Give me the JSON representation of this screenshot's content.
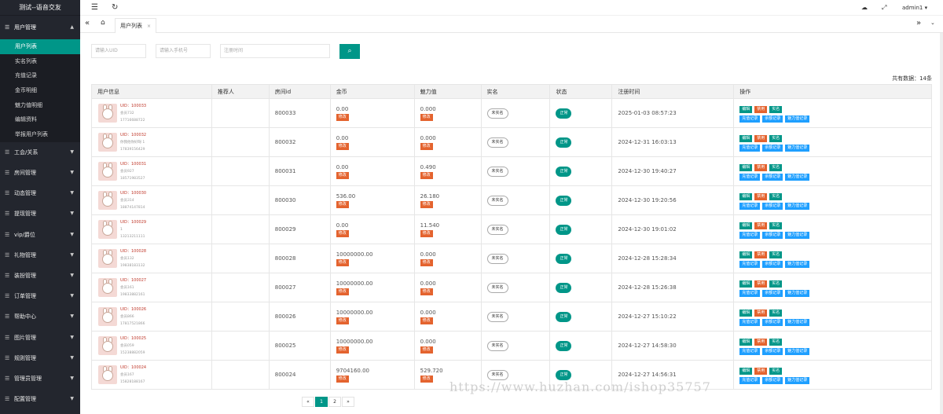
{
  "app_title": "测试--语音交友",
  "sidebar": {
    "groups": [
      {
        "label": "用户管理",
        "expanded": true,
        "items": [
          "用户列表",
          "实名列表",
          "充值记录",
          "金币明细",
          "魅力值明细",
          "编辑资料",
          "举报用户列表"
        ]
      },
      {
        "label": "工会/关系"
      },
      {
        "label": "房间管理"
      },
      {
        "label": "动态管理"
      },
      {
        "label": "提现管理"
      },
      {
        "label": "vip/爵位"
      },
      {
        "label": "礼物管理"
      },
      {
        "label": "装扮管理"
      },
      {
        "label": "订单管理"
      },
      {
        "label": "帮助中心"
      },
      {
        "label": "图片管理"
      },
      {
        "label": "规则管理"
      },
      {
        "label": "管理员管理"
      },
      {
        "label": "配置管理"
      }
    ]
  },
  "topbar": {
    "user": "admin1"
  },
  "tabs": [
    {
      "label": "用户列表",
      "active": true
    }
  ],
  "search": {
    "uid_placeholder": "请输入UID",
    "phone_placeholder": "请输入手机号",
    "date_placeholder": "注册时间"
  },
  "total_label": "共有数据：14条",
  "table": {
    "headers": [
      "用户信息",
      "推荐人",
      "房间id",
      "金币",
      "魅力值",
      "实名",
      "状态",
      "注册时间",
      "操作"
    ],
    "modify_label": "修改",
    "realname_label": "未实名",
    "status_label": "正常",
    "actions": [
      "编辑",
      "禁用",
      "实名",
      "充值记录",
      "余额记录",
      "魅力值记录"
    ],
    "rows": [
      {
        "uid": "UID：100033",
        "name": "会员732",
        "phone": "17716688722",
        "room": "800033",
        "coin": "0.00",
        "charm": "0.000",
        "time": "2025-01-03 08:57:23"
      },
      {
        "uid": "UID：100032",
        "name": "你我他你好呀 1",
        "phone": "17839156429",
        "room": "800032",
        "coin": "0.00",
        "charm": "0.000",
        "time": "2024-12-31 16:03:13"
      },
      {
        "uid": "UID：100031",
        "name": "会员927",
        "phone": "18571983527",
        "room": "800031",
        "coin": "0.00",
        "charm": "0.490",
        "time": "2024-12-30 19:40:27"
      },
      {
        "uid": "UID：100030",
        "name": "会员314",
        "phone": "18874147814",
        "room": "800030",
        "coin": "536.00",
        "charm": "26.180",
        "time": "2024-12-30 19:20:56"
      },
      {
        "uid": "UID：100029",
        "name": "1",
        "phone": "13213211111",
        "room": "800029",
        "coin": "0.00",
        "charm": "11.540",
        "time": "2024-12-30 19:01:02"
      },
      {
        "uid": "UID：100028",
        "name": "会员132",
        "phone": "19838183132",
        "room": "800028",
        "coin": "10000000.00",
        "charm": "0.000",
        "time": "2024-12-28 15:28:34"
      },
      {
        "uid": "UID：100027",
        "name": "会员161",
        "phone": "19833882161",
        "room": "800027",
        "coin": "10000000.00",
        "charm": "0.000",
        "time": "2024-12-28 15:26:38"
      },
      {
        "uid": "UID：100026",
        "name": "会员866",
        "phone": "17817521866",
        "room": "800026",
        "coin": "10000000.00",
        "charm": "0.000",
        "time": "2024-12-27 15:10:22"
      },
      {
        "uid": "UID：100025",
        "name": "会员059",
        "phone": "15238882059",
        "room": "800025",
        "coin": "10000000.00",
        "charm": "0.000",
        "time": "2024-12-27 14:58:30"
      },
      {
        "uid": "UID：100024",
        "name": "会员167",
        "phone": "15828188167",
        "room": "800024",
        "coin": "9704160.00",
        "charm": "529.720",
        "time": "2024-12-27 14:56:31"
      }
    ]
  },
  "pager": {
    "prev": "«",
    "pages": [
      "1",
      "2"
    ],
    "next": "»"
  },
  "watermark": "https://www.huzhan.com/ishop35757",
  "colors": {
    "accent": "#009688",
    "danger": "#e4632e",
    "info": "#1e9fff",
    "sidebar": "#23262e"
  }
}
